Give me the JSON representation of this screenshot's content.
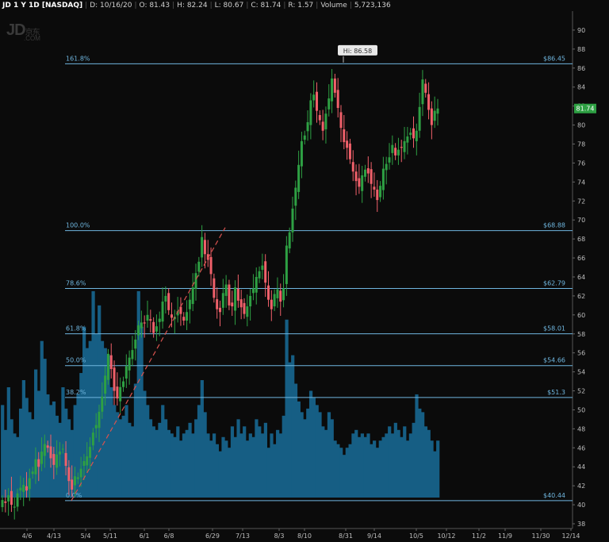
{
  "header": {
    "symbol_label": "JD 1 Y 1D [NASDAQ]",
    "date": "D: 10/16/20",
    "open": "O: 81.43",
    "high": "H: 82.24",
    "low": "L: 80.67",
    "close": "C: 81.74",
    "range": "R: 1.57",
    "volume_label": "Volume",
    "volume_value": "5,723,136"
  },
  "watermark": {
    "main": "JD",
    "sub": "京东",
    "dot": ".COM"
  },
  "colors": {
    "up": "#2ea043",
    "down": "#f0606a",
    "fib": "#6fb6df",
    "volume": "#165e84",
    "price_badge": "#2ea043"
  },
  "chart_data": {
    "type": "candlestick",
    "ylim": [
      37.5,
      92
    ],
    "y_ticks": [
      38,
      40,
      42,
      44,
      46,
      48,
      50,
      52,
      54,
      56,
      58,
      60,
      62,
      64,
      66,
      68,
      70,
      72,
      74,
      76,
      78,
      80,
      82,
      84,
      86,
      88,
      90
    ],
    "x_ticks": [
      "4/6",
      "4/13",
      "5/4",
      "5/11",
      "6/1",
      "6/8",
      "6/29",
      "7/13",
      "8/3",
      "8/10",
      "8/31",
      "9/14",
      "10/5",
      "10/12",
      "11/2",
      "11/9",
      "11/30",
      "12/14"
    ],
    "last_price": "81.74",
    "high_annotation": {
      "label": "Hi: 86.58",
      "value": 86.58
    },
    "fib_levels": [
      {
        "pct": "161.8%",
        "value": 86.45,
        "label": "$86.45"
      },
      {
        "pct": "100.0%",
        "value": 68.88,
        "label": "$68.88"
      },
      {
        "pct": "78.6%",
        "value": 62.79,
        "label": "$62.79"
      },
      {
        "pct": "61.8%",
        "value": 58.01,
        "label": "$58.01"
      },
      {
        "pct": "50.0%",
        "value": 54.66,
        "label": "$54.66"
      },
      {
        "pct": "38.2%",
        "value": 51.3,
        "label": "$51.3"
      },
      {
        "pct": "0.0%",
        "value": 40.44,
        "label": "$40.44"
      }
    ],
    "trend_line": {
      "from": 40.44,
      "to": 69.2
    },
    "close_series": [
      40.5,
      40.2,
      41.0,
      40.0,
      39.8,
      41.2,
      41.8,
      42.1,
      41.5,
      42.8,
      43.5,
      44.8,
      44.0,
      45.6,
      46.4,
      46.0,
      44.9,
      44.2,
      45.3,
      45.6,
      45.9,
      44.1,
      42.5,
      41.6,
      43.0,
      42.9,
      43.8,
      44.6,
      45.1,
      46.1,
      47.6,
      48.4,
      49.8,
      51.4,
      53.6,
      55.9,
      54.3,
      52.0,
      51.2,
      52.4,
      53.0,
      54.6,
      55.5,
      56.3,
      57.4,
      58.9,
      59.2,
      59.1,
      60.0,
      59.4,
      58.1,
      58.8,
      59.6,
      61.4,
      62.0,
      60.5,
      59.7,
      59.8,
      60.4,
      60.1,
      59.4,
      60.3,
      61.6,
      62.9,
      64.4,
      65.6,
      68.2,
      66.4,
      65.8,
      64.3,
      61.8,
      60.6,
      60.3,
      62.3,
      63.2,
      61.0,
      60.9,
      62.9,
      61.5,
      60.8,
      60.1,
      60.9,
      62.0,
      62.8,
      64.0,
      64.6,
      65.2,
      63.4,
      61.6,
      60.6,
      62.2,
      62.7,
      61.4,
      62.8,
      67.3,
      68.7,
      71.2,
      73.4,
      75.8,
      78.3,
      78.9,
      80.3,
      82.6,
      83.2,
      81.5,
      80.5,
      79.4,
      81.2,
      82.8,
      84.9,
      83.4,
      81.8,
      79.7,
      78.2,
      77.6,
      76.4,
      75.1,
      74.1,
      73.5,
      74.7,
      75.3,
      74.9,
      73.8,
      73.2,
      72.1,
      73.6,
      75.4,
      75.9,
      76.6,
      77.9,
      76.8,
      77.4,
      77.6,
      78.3,
      78.8,
      79.2,
      78.6,
      79.4,
      81.9,
      84.8,
      83.4,
      81.6,
      80.0,
      81.5,
      81.74
    ],
    "volume_series": [
      26,
      19,
      31,
      22,
      18,
      17,
      25,
      33,
      28,
      24,
      22,
      36,
      30,
      44,
      39,
      29,
      26,
      27,
      23,
      21,
      31,
      25,
      22,
      19,
      26,
      29,
      35,
      48,
      42,
      44,
      58,
      46,
      54,
      44,
      42,
      40,
      31,
      26,
      24,
      22,
      23,
      26,
      21,
      20,
      32,
      58,
      48,
      30,
      26,
      22,
      20,
      19,
      21,
      26,
      22,
      19,
      18,
      17,
      20,
      16,
      18,
      19,
      21,
      18,
      22,
      26,
      33,
      24,
      18,
      16,
      18,
      15,
      13,
      17,
      16,
      14,
      20,
      17,
      22,
      18,
      20,
      16,
      18,
      17,
      22,
      20,
      18,
      21,
      14,
      18,
      15,
      19,
      18,
      23,
      50,
      38,
      40,
      32,
      27,
      24,
      22,
      25,
      30,
      28,
      26,
      24,
      20,
      19,
      24,
      22,
      16,
      15,
      14,
      12,
      14,
      15,
      18,
      19,
      17,
      18,
      17,
      18,
      15,
      16,
      14,
      16,
      17,
      18,
      20,
      18,
      21,
      19,
      17,
      20,
      16,
      18,
      21,
      29,
      25,
      24,
      20,
      19,
      16,
      13,
      16
    ]
  }
}
